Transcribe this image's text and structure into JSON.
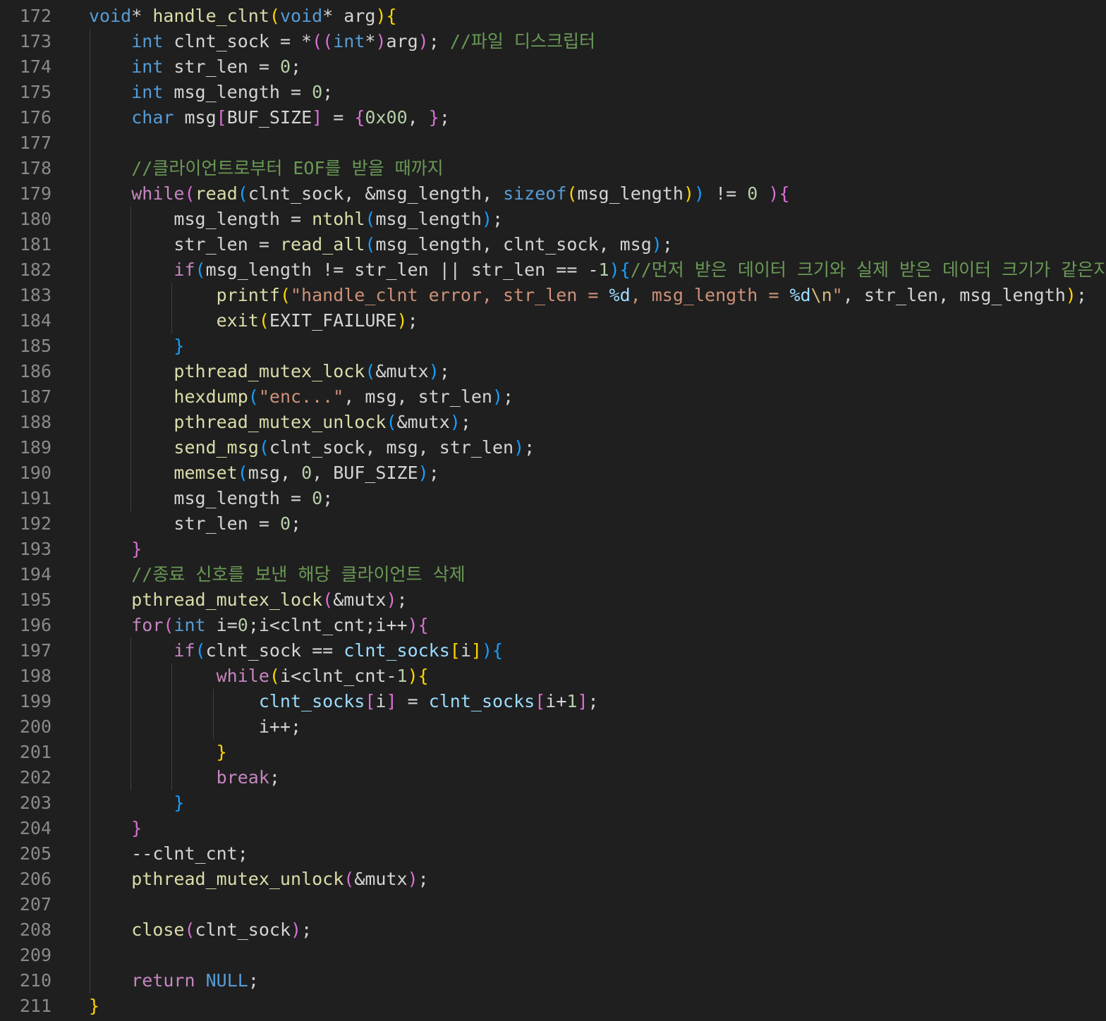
{
  "editor": {
    "first_line": 172,
    "lines": [
      {
        "n": "172",
        "tokens": [
          [
            "kw",
            "void"
          ],
          [
            "op",
            "* "
          ],
          [
            "fn",
            "handle_clnt"
          ],
          [
            "p1",
            "("
          ],
          [
            "kw",
            "void"
          ],
          [
            "op",
            "* "
          ],
          [
            "var",
            "arg"
          ],
          [
            "p1",
            "){"
          ]
        ]
      },
      {
        "n": "173",
        "tokens": [
          [
            "ws",
            "    "
          ],
          [
            "kw",
            "int"
          ],
          [
            "var",
            " clnt_sock "
          ],
          [
            "op",
            "= *"
          ],
          [
            "p2",
            "(("
          ],
          [
            "kw",
            "int"
          ],
          [
            "op",
            "*"
          ],
          [
            "p2",
            ")"
          ],
          [
            "var",
            "arg"
          ],
          [
            "p2",
            ")"
          ],
          [
            "op",
            "; "
          ],
          [
            "cm",
            "//파일 디스크립터"
          ]
        ]
      },
      {
        "n": "174",
        "tokens": [
          [
            "ws",
            "    "
          ],
          [
            "kw",
            "int"
          ],
          [
            "var",
            " str_len "
          ],
          [
            "op",
            "= "
          ],
          [
            "num",
            "0"
          ],
          [
            "op",
            ";"
          ]
        ]
      },
      {
        "n": "175",
        "tokens": [
          [
            "ws",
            "    "
          ],
          [
            "kw",
            "int"
          ],
          [
            "var",
            " msg_length "
          ],
          [
            "op",
            "= "
          ],
          [
            "num",
            "0"
          ],
          [
            "op",
            ";"
          ]
        ]
      },
      {
        "n": "176",
        "tokens": [
          [
            "ws",
            "    "
          ],
          [
            "kw",
            "char"
          ],
          [
            "var",
            " msg"
          ],
          [
            "p2",
            "["
          ],
          [
            "var",
            "BUF_SIZE"
          ],
          [
            "p2",
            "]"
          ],
          [
            "op",
            " = "
          ],
          [
            "p2",
            "{"
          ],
          [
            "num",
            "0x00"
          ],
          [
            "op",
            ", "
          ],
          [
            "p2",
            "}"
          ],
          [
            "op",
            ";"
          ]
        ]
      },
      {
        "n": "177",
        "tokens": []
      },
      {
        "n": "178",
        "tokens": [
          [
            "ws",
            "    "
          ],
          [
            "cm",
            "//클라이언트로부터 EOF를 받을 때까지"
          ]
        ]
      },
      {
        "n": "179",
        "tokens": [
          [
            "ws",
            "    "
          ],
          [
            "ctrl",
            "while"
          ],
          [
            "p2",
            "("
          ],
          [
            "fn",
            "read"
          ],
          [
            "p3",
            "("
          ],
          [
            "var",
            "clnt_sock, &msg_length, "
          ],
          [
            "kw",
            "sizeof"
          ],
          [
            "p1",
            "("
          ],
          [
            "var",
            "msg_length"
          ],
          [
            "p1",
            ")"
          ],
          [
            "p3",
            ")"
          ],
          [
            "op",
            " != "
          ],
          [
            "num",
            "0"
          ],
          [
            "op",
            " "
          ],
          [
            "p2",
            ")"
          ],
          [
            "p2",
            "{"
          ]
        ]
      },
      {
        "n": "180",
        "tokens": [
          [
            "ws",
            "        "
          ],
          [
            "var",
            "msg_length "
          ],
          [
            "op",
            "= "
          ],
          [
            "fn",
            "ntohl"
          ],
          [
            "p3",
            "("
          ],
          [
            "var",
            "msg_length"
          ],
          [
            "p3",
            ")"
          ],
          [
            "op",
            ";"
          ]
        ]
      },
      {
        "n": "181",
        "tokens": [
          [
            "ws",
            "        "
          ],
          [
            "var",
            "str_len "
          ],
          [
            "op",
            "= "
          ],
          [
            "fn",
            "read_all"
          ],
          [
            "p3",
            "("
          ],
          [
            "var",
            "msg_length, clnt_sock, msg"
          ],
          [
            "p3",
            ")"
          ],
          [
            "op",
            ";"
          ]
        ]
      },
      {
        "n": "182",
        "tokens": [
          [
            "ws",
            "        "
          ],
          [
            "ctrl",
            "if"
          ],
          [
            "p3",
            "("
          ],
          [
            "var",
            "msg_length != str_len || str_len == -"
          ],
          [
            "num",
            "1"
          ],
          [
            "p3",
            ")"
          ],
          [
            "p3",
            "{"
          ],
          [
            "cm",
            "//먼저 받은 데이터 크기와 실제 받은 데이터 크기가 같은지 비교"
          ]
        ]
      },
      {
        "n": "183",
        "tokens": [
          [
            "ws",
            "            "
          ],
          [
            "fn",
            "printf"
          ],
          [
            "p1",
            "("
          ],
          [
            "str",
            "\"handle_clnt error, str_len = "
          ],
          [
            "fmt",
            "%d"
          ],
          [
            "str",
            ", msg_length = "
          ],
          [
            "fmt",
            "%d"
          ],
          [
            "esc",
            "\\n"
          ],
          [
            "str",
            "\""
          ],
          [
            "var",
            ", str_len, msg_length"
          ],
          [
            "p1",
            ")"
          ],
          [
            "op",
            ";"
          ]
        ]
      },
      {
        "n": "184",
        "tokens": [
          [
            "ws",
            "            "
          ],
          [
            "fn",
            "exit"
          ],
          [
            "p1",
            "("
          ],
          [
            "var",
            "EXIT_FAILURE"
          ],
          [
            "p1",
            ")"
          ],
          [
            "op",
            ";"
          ]
        ]
      },
      {
        "n": "185",
        "tokens": [
          [
            "ws",
            "        "
          ],
          [
            "p3",
            "}"
          ]
        ]
      },
      {
        "n": "186",
        "tokens": [
          [
            "ws",
            "        "
          ],
          [
            "fn",
            "pthread_mutex_lock"
          ],
          [
            "p3",
            "("
          ],
          [
            "var",
            "&mutx"
          ],
          [
            "p3",
            ")"
          ],
          [
            "op",
            ";"
          ]
        ]
      },
      {
        "n": "187",
        "tokens": [
          [
            "ws",
            "        "
          ],
          [
            "fn",
            "hexdump"
          ],
          [
            "p3",
            "("
          ],
          [
            "str",
            "\"enc...\""
          ],
          [
            "var",
            ", msg, str_len"
          ],
          [
            "p3",
            ")"
          ],
          [
            "op",
            ";"
          ]
        ]
      },
      {
        "n": "188",
        "tokens": [
          [
            "ws",
            "        "
          ],
          [
            "fn",
            "pthread_mutex_unlock"
          ],
          [
            "p3",
            "("
          ],
          [
            "var",
            "&mutx"
          ],
          [
            "p3",
            ")"
          ],
          [
            "op",
            ";"
          ]
        ]
      },
      {
        "n": "189",
        "tokens": [
          [
            "ws",
            "        "
          ],
          [
            "fn",
            "send_msg"
          ],
          [
            "p3",
            "("
          ],
          [
            "var",
            "clnt_sock, msg, str_len"
          ],
          [
            "p3",
            ")"
          ],
          [
            "op",
            ";"
          ]
        ]
      },
      {
        "n": "190",
        "tokens": [
          [
            "ws",
            "        "
          ],
          [
            "fn",
            "memset"
          ],
          [
            "p3",
            "("
          ],
          [
            "var",
            "msg, "
          ],
          [
            "num",
            "0"
          ],
          [
            "var",
            ", BUF_SIZE"
          ],
          [
            "p3",
            ")"
          ],
          [
            "op",
            ";"
          ]
        ]
      },
      {
        "n": "191",
        "tokens": [
          [
            "ws",
            "        "
          ],
          [
            "var",
            "msg_length "
          ],
          [
            "op",
            "= "
          ],
          [
            "num",
            "0"
          ],
          [
            "op",
            ";"
          ]
        ]
      },
      {
        "n": "192",
        "tokens": [
          [
            "ws",
            "        "
          ],
          [
            "var",
            "str_len "
          ],
          [
            "op",
            "= "
          ],
          [
            "num",
            "0"
          ],
          [
            "op",
            ";"
          ]
        ]
      },
      {
        "n": "193",
        "tokens": [
          [
            "ws",
            "    "
          ],
          [
            "p2",
            "}"
          ]
        ]
      },
      {
        "n": "194",
        "tokens": [
          [
            "ws",
            "    "
          ],
          [
            "cm",
            "//종료 신호를 보낸 해당 클라이언트 삭제"
          ]
        ]
      },
      {
        "n": "195",
        "tokens": [
          [
            "ws",
            "    "
          ],
          [
            "fn",
            "pthread_mutex_lock"
          ],
          [
            "p2",
            "("
          ],
          [
            "var",
            "&mutx"
          ],
          [
            "p2",
            ")"
          ],
          [
            "op",
            ";"
          ]
        ]
      },
      {
        "n": "196",
        "tokens": [
          [
            "ws",
            "    "
          ],
          [
            "ctrl",
            "for"
          ],
          [
            "p2",
            "("
          ],
          [
            "kw",
            "int"
          ],
          [
            "var",
            " i="
          ],
          [
            "num",
            "0"
          ],
          [
            "var",
            ";i<clnt_cnt;i++"
          ],
          [
            "p2",
            ")"
          ],
          [
            "p2",
            "{"
          ]
        ]
      },
      {
        "n": "197",
        "tokens": [
          [
            "ws",
            "        "
          ],
          [
            "ctrl",
            "if"
          ],
          [
            "p3",
            "("
          ],
          [
            "var",
            "clnt_sock == "
          ],
          [
            "arr",
            "clnt_socks"
          ],
          [
            "p1",
            "["
          ],
          [
            "var",
            "i"
          ],
          [
            "p1",
            "]"
          ],
          [
            "p3",
            ")"
          ],
          [
            "p3",
            "{"
          ]
        ]
      },
      {
        "n": "198",
        "tokens": [
          [
            "ws",
            "            "
          ],
          [
            "ctrl",
            "while"
          ],
          [
            "p1",
            "("
          ],
          [
            "var",
            "i<clnt_cnt-"
          ],
          [
            "num",
            "1"
          ],
          [
            "p1",
            ")"
          ],
          [
            "p1",
            "{"
          ]
        ]
      },
      {
        "n": "199",
        "tokens": [
          [
            "ws",
            "                "
          ],
          [
            "arr",
            "clnt_socks"
          ],
          [
            "p2",
            "["
          ],
          [
            "var",
            "i"
          ],
          [
            "p2",
            "]"
          ],
          [
            "op",
            " = "
          ],
          [
            "arr",
            "clnt_socks"
          ],
          [
            "p2",
            "["
          ],
          [
            "var",
            "i+"
          ],
          [
            "num",
            "1"
          ],
          [
            "p2",
            "]"
          ],
          [
            "op",
            ";"
          ]
        ]
      },
      {
        "n": "200",
        "tokens": [
          [
            "ws",
            "                "
          ],
          [
            "var",
            "i++;"
          ]
        ]
      },
      {
        "n": "201",
        "tokens": [
          [
            "ws",
            "            "
          ],
          [
            "p1",
            "}"
          ]
        ]
      },
      {
        "n": "202",
        "tokens": [
          [
            "ws",
            "            "
          ],
          [
            "ctrl",
            "break"
          ],
          [
            "op",
            ";"
          ]
        ]
      },
      {
        "n": "203",
        "tokens": [
          [
            "ws",
            "        "
          ],
          [
            "p3",
            "}"
          ]
        ]
      },
      {
        "n": "204",
        "tokens": [
          [
            "ws",
            "    "
          ],
          [
            "p2",
            "}"
          ]
        ]
      },
      {
        "n": "205",
        "tokens": [
          [
            "ws",
            "    "
          ],
          [
            "var",
            "--clnt_cnt;"
          ]
        ]
      },
      {
        "n": "206",
        "tokens": [
          [
            "ws",
            "    "
          ],
          [
            "fn",
            "pthread_mutex_unlock"
          ],
          [
            "p2",
            "("
          ],
          [
            "var",
            "&mutx"
          ],
          [
            "p2",
            ")"
          ],
          [
            "op",
            ";"
          ]
        ]
      },
      {
        "n": "207",
        "tokens": []
      },
      {
        "n": "208",
        "tokens": [
          [
            "ws",
            "    "
          ],
          [
            "fn",
            "close"
          ],
          [
            "p2",
            "("
          ],
          [
            "var",
            "clnt_sock"
          ],
          [
            "p2",
            ")"
          ],
          [
            "op",
            ";"
          ]
        ]
      },
      {
        "n": "209",
        "tokens": []
      },
      {
        "n": "210",
        "tokens": [
          [
            "ws",
            "    "
          ],
          [
            "ctrl",
            "return"
          ],
          [
            "op",
            " "
          ],
          [
            "kw",
            "NULL"
          ],
          [
            "op",
            ";"
          ]
        ]
      },
      {
        "n": "211",
        "tokens": [
          [
            "p1",
            "}"
          ]
        ]
      }
    ]
  },
  "colors": {
    "background": "#1f1f1f",
    "line_number": "#8a8a8a",
    "keyword": "#569cd6",
    "control": "#c586c0",
    "function": "#dcdcaa",
    "comment": "#6a9955",
    "string": "#ce9178",
    "number": "#b5cea8",
    "bracket_1": "#ffd700",
    "bracket_2": "#da70d6",
    "bracket_3": "#179fff"
  }
}
